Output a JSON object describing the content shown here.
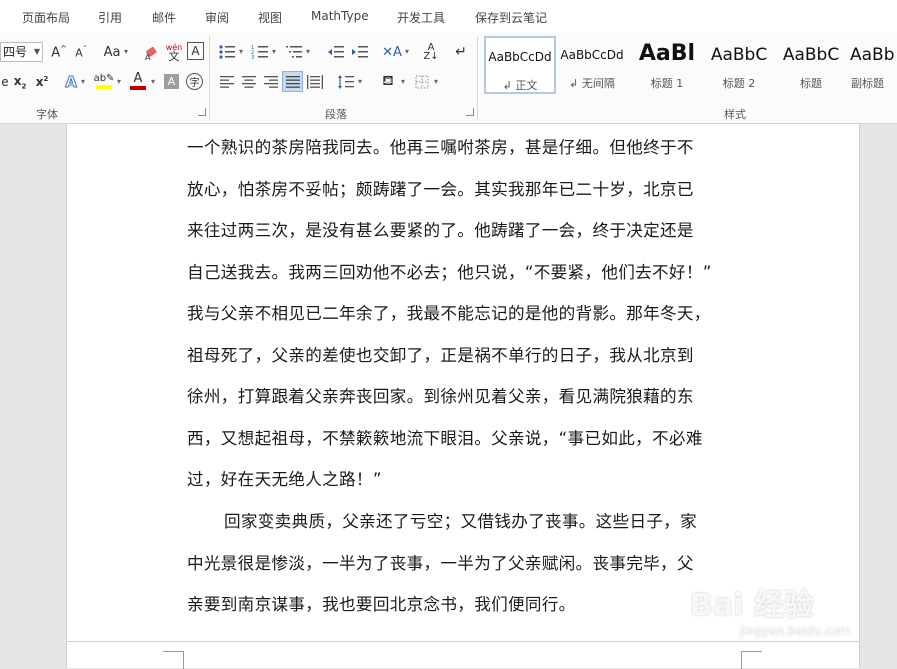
{
  "tabs": [
    "页面布局",
    "引用",
    "邮件",
    "审阅",
    "视图",
    "MathType",
    "开发工具",
    "保存到云笔记"
  ],
  "font_group": {
    "size_value": "四号",
    "label": "字体",
    "change_case_label": "Aa",
    "phonetic_label": "wén"
  },
  "paragraph_group": {
    "label": "段落"
  },
  "styles_group": {
    "label": "样式",
    "items": [
      {
        "sample": "AaBbCcDd",
        "name": "正文",
        "selected": true
      },
      {
        "sample": "AaBbCcDd",
        "name": "无间隔",
        "selected": false
      },
      {
        "sample": "AaBl",
        "name": "标题 1",
        "selected": false
      },
      {
        "sample": "AaBbC",
        "name": "标题 2",
        "selected": false
      },
      {
        "sample": "AaBbC",
        "name": "标题",
        "selected": false
      },
      {
        "sample": "AaBb",
        "name": "副标题",
        "selected": false
      }
    ]
  },
  "document": {
    "paragraph1": [
      "一个熟识的茶房陪我同去。他再三嘱咐茶房，甚是仔细。但他终于不",
      "放心，怕茶房不妥帖；颇踌躇了一会。其实我那年已二十岁，北京已",
      "来往过两三次，是没有甚么要紧的了。他踌躇了一会，终于决定还是",
      "自己送我去。我两三回劝他不必去；他只说，“不要紧，他们去不好！”",
      "我与父亲不相见已二年余了，我最不能忘记的是他的背影。那年冬天，",
      "祖母死了，父亲的差使也交卸了，正是祸不单行的日子，我从北京到",
      "徐州，打算跟着父亲奔丧回家。到徐州见着父亲，看见满院狼藉的东",
      "西，又想起祖母，不禁簌簌地流下眼泪。父亲说，“事已如此，不必难",
      "过，好在天无绝人之路！”"
    ],
    "paragraph2": [
      "回家变卖典质，父亲还了亏空；又借钱办了丧事。这些日子，家",
      "中光景很是惨淡，一半为了丧事，一半为了父亲赋闲。丧事完毕，父",
      "亲要到南京谋事，我也要回北京念书，我们便同行。"
    ]
  },
  "watermark": {
    "main": "Bai 经验",
    "sub": "jingyan.baidu.com"
  },
  "colors": {
    "highlight": "#ffff00",
    "font_color": "#c00000",
    "selected_style_border": "#aecbe8",
    "ribbon_bg": "#fbfbfb",
    "doc_bg": "#e6e6e6"
  }
}
